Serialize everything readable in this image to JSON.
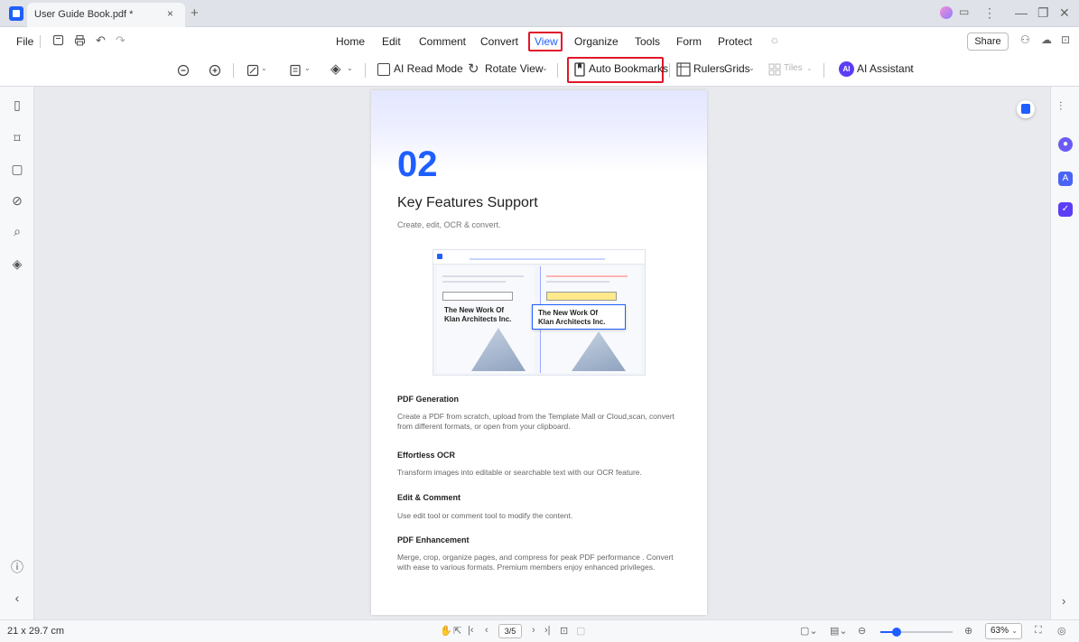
{
  "tab": {
    "title": "User Guide Book.pdf *",
    "close": "×",
    "new": "+"
  },
  "window_controls": [
    "⋮",
    "—",
    "❐",
    "✕"
  ],
  "menu": {
    "file": "File",
    "items": [
      "Home",
      "Edit",
      "Comment",
      "Convert",
      "View",
      "Organize",
      "Tools",
      "Form",
      "Protect"
    ],
    "active": "View",
    "share": "Share"
  },
  "toolbar": {
    "ai_read_mode": "AI Read Mode",
    "rotate_view": "Rotate View",
    "auto_bookmarks": "Auto Bookmarks",
    "rulers": "Rulers",
    "grids": "Grids",
    "tiles": "Tiles",
    "ai_badge": "AI",
    "ai_assistant": "AI Assistant"
  },
  "document": {
    "chapter_number": "02",
    "chapter_title": "Key Features Support",
    "chapter_subtitle": "Create, edit, OCR & convert.",
    "screenshot_card_left": "The New Work Of\nKlan Architects Inc.",
    "screenshot_card_right": "The New Work Of\nKlan Architects Inc.",
    "features": [
      {
        "title": "PDF Generation",
        "desc": "Create a PDF from scratch, upload from the Template Mall or Cloud,scan, convert from different formats, or open from your clipboard."
      },
      {
        "title": "Effortless OCR",
        "desc": "Transform images into editable or searchable text with our OCR feature."
      },
      {
        "title": "Edit & Comment",
        "desc": "Use edit tool or comment tool to modify the content."
      },
      {
        "title": "PDF Enhancement",
        "desc": "Merge, crop, organize pages, and compress for peak PDF performance . Convert with ease to various formats. Premium members enjoy enhanced privileges."
      }
    ]
  },
  "status": {
    "page_size": "21 x 29.7 cm",
    "page_indicator": "3/5",
    "zoom": "63%",
    "zoom_fraction": 0.22
  },
  "colors": {
    "accent": "#1f5fff",
    "highlight_border": "#e0162b"
  }
}
